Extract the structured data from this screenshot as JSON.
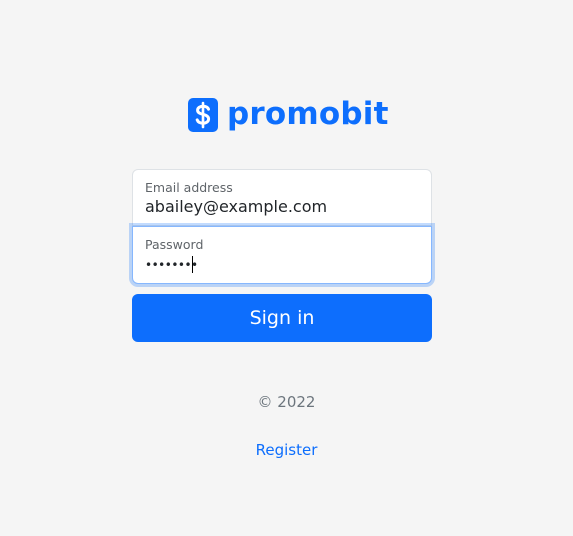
{
  "brand": {
    "name": "promobit",
    "icon": "dollar-sign-icon",
    "color": "#0d6efd"
  },
  "form": {
    "email": {
      "label": "Email address",
      "value": "abailey@example.com"
    },
    "password": {
      "label": "Password",
      "masked_value": "••••••••"
    },
    "submit_label": "Sign in"
  },
  "footer": {
    "copyright": "© 2022",
    "register_link": "Register"
  },
  "colors": {
    "background": "#f5f5f5",
    "primary": "#0d6efd",
    "muted_text": "#6c757d"
  }
}
